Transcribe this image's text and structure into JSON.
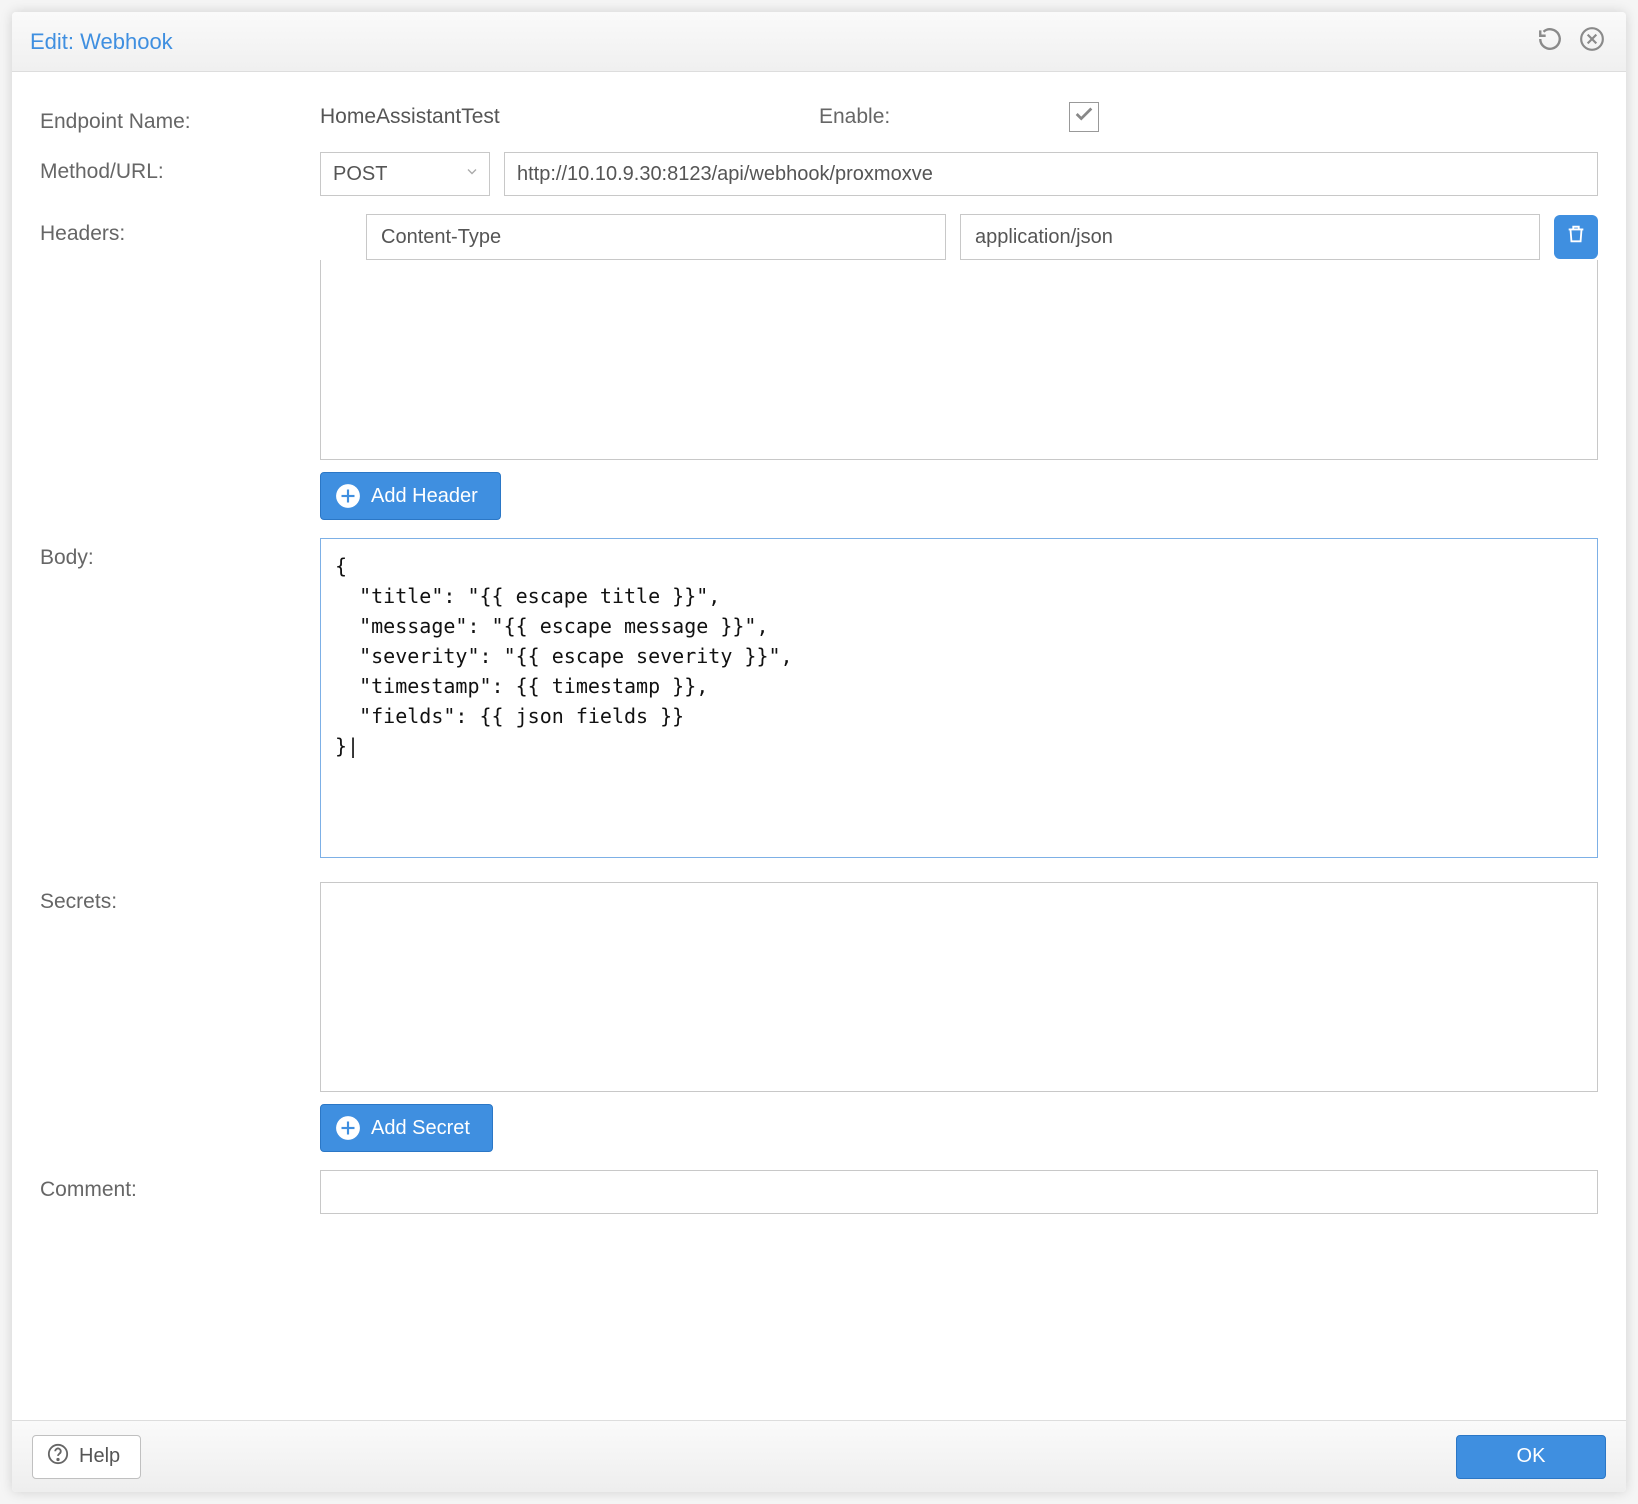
{
  "dialog": {
    "title": "Edit: Webhook"
  },
  "form": {
    "endpoint_name_label": "Endpoint Name:",
    "endpoint_name_value": "HomeAssistantTest",
    "enable_label": "Enable:",
    "enable_checked": true,
    "method_url_label": "Method/URL:",
    "method_value": "POST",
    "url_value": "http://10.10.9.30:8123/api/webhook/proxmoxve",
    "headers_label": "Headers:",
    "headers": [
      {
        "key": "Content-Type",
        "value": "application/json"
      }
    ],
    "add_header_label": "Add Header",
    "body_label": "Body:",
    "body_value": "{\n  \"title\": \"{{ escape title }}\",\n  \"message\": \"{{ escape message }}\",\n  \"severity\": \"{{ escape severity }}\",\n  \"timestamp\": {{ timestamp }},\n  \"fields\": {{ json fields }}\n}|",
    "secrets_label": "Secrets:",
    "add_secret_label": "Add Secret",
    "comment_label": "Comment:",
    "comment_value": ""
  },
  "footer": {
    "help_label": "Help",
    "ok_label": "OK"
  }
}
